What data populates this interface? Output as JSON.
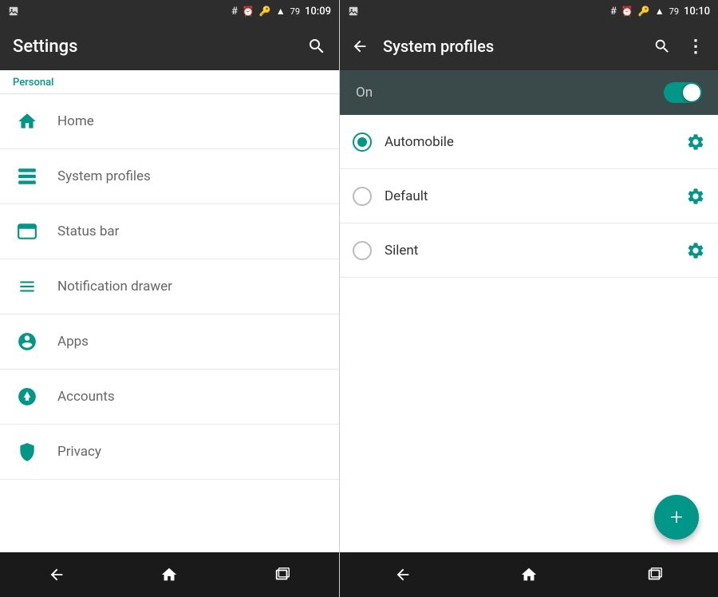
{
  "left": {
    "status_bar": {
      "time": "10:09",
      "icons": [
        "image",
        "hash",
        "alarm",
        "key",
        "signal",
        "battery"
      ]
    },
    "header": {
      "title": "Settings",
      "search_label": "search"
    },
    "personal_label": "Personal",
    "menu_items": [
      {
        "id": "home",
        "label": "Home",
        "icon": "home"
      },
      {
        "id": "system-profiles",
        "label": "System profiles",
        "icon": "profiles"
      },
      {
        "id": "status-bar",
        "label": "Status bar",
        "icon": "statusbar"
      },
      {
        "id": "notification-drawer",
        "label": "Notification drawer",
        "icon": "notification"
      },
      {
        "id": "apps",
        "label": "Apps",
        "icon": "apps"
      },
      {
        "id": "accounts",
        "label": "Accounts",
        "icon": "accounts"
      },
      {
        "id": "privacy",
        "label": "Privacy",
        "icon": "privacy"
      }
    ],
    "nav": {
      "back_label": "back",
      "home_label": "home",
      "recents_label": "recents"
    }
  },
  "right": {
    "status_bar": {
      "time": "10:10",
      "icons": [
        "image",
        "hash",
        "alarm",
        "key",
        "signal",
        "battery"
      ]
    },
    "header": {
      "back_label": "back",
      "title": "System profiles",
      "search_label": "search",
      "more_label": "more options"
    },
    "toggle": {
      "label": "On",
      "state": true
    },
    "profiles": [
      {
        "id": "automobile",
        "label": "Automobile",
        "selected": true
      },
      {
        "id": "default",
        "label": "Default",
        "selected": false
      },
      {
        "id": "silent",
        "label": "Silent",
        "selected": false
      }
    ],
    "fab_label": "+",
    "nav": {
      "back_label": "back",
      "home_label": "home",
      "recents_label": "recents"
    }
  }
}
